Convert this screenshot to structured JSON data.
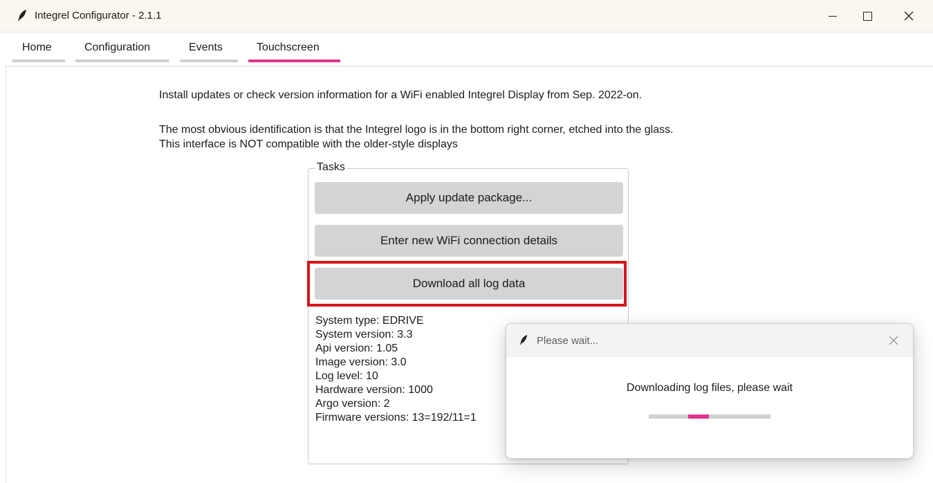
{
  "window": {
    "title": "Integrel Configurator - 2.1.1",
    "icon": "feather-icon"
  },
  "tabs": [
    {
      "label": "Home",
      "active": false
    },
    {
      "label": "Configuration",
      "active": false
    },
    {
      "label": "Events",
      "active": false
    },
    {
      "label": "Touchscreen",
      "active": true
    }
  ],
  "accent_color": "#e0348c",
  "intro": {
    "line1": "Install updates or check version information for a WiFi enabled Integrel Display from Sep. 2022-on.",
    "line2": "The most obvious identification is that the Integrel logo is in the bottom right corner, etched into the glass.",
    "line3": "This interface is NOT compatible with the older-style displays"
  },
  "tasks": {
    "legend": "Tasks",
    "buttons": [
      {
        "label": "Apply update package..."
      },
      {
        "label": "Enter new WiFi connection details"
      },
      {
        "label": "Download all log data",
        "highlighted": true
      }
    ],
    "highlight_color": "#d8141b"
  },
  "info": [
    "System type: EDRIVE",
    "System version: 3.3",
    "Api version: 1.05",
    "Image version: 3.0",
    "Log level: 10",
    "Hardware version: 1000",
    "Argo version: 2",
    "Firmware versions: 13=192/11=1"
  ],
  "dialog": {
    "title": "Please wait...",
    "message": "Downloading log files, please wait",
    "progress_indeterminate": true
  }
}
